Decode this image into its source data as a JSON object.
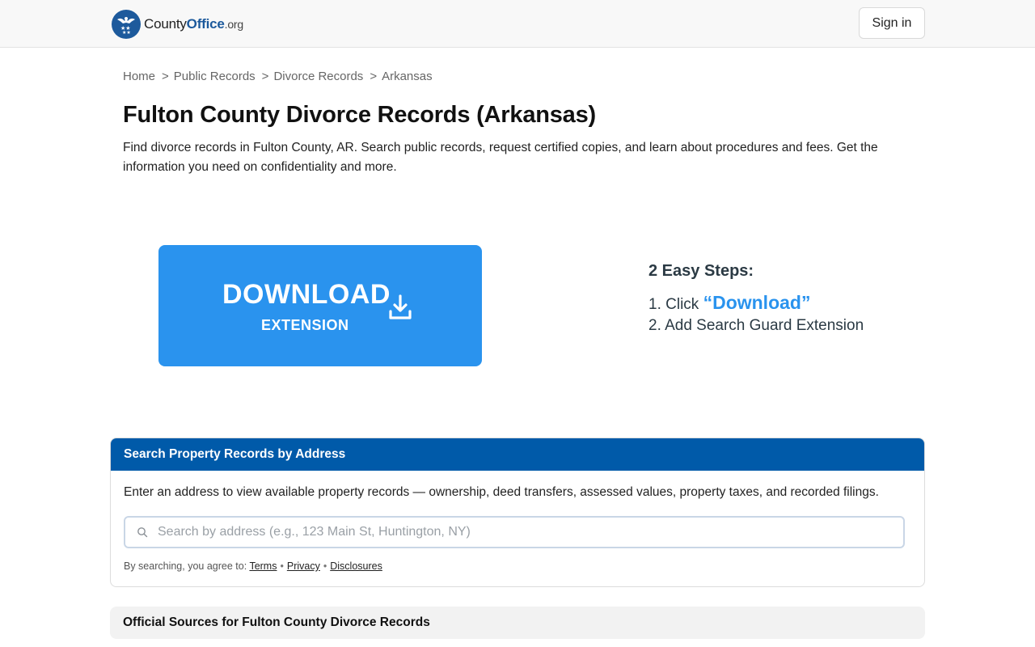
{
  "header": {
    "logo": {
      "name_regular": "County",
      "name_bold": "Office",
      "tld": ".org"
    },
    "signin_label": "Sign in"
  },
  "breadcrumb": [
    "Home",
    "Public Records",
    "Divorce Records",
    "Arkansas"
  ],
  "page": {
    "title": "Fulton County Divorce Records (Arkansas)",
    "intro": "Find divorce records in Fulton County, AR. Search public records, request certified copies, and learn about procedures and fees. Get the information you need on confidentiality and more."
  },
  "download": {
    "main_label": "DOWNLOAD",
    "sub_label": "EXTENSION",
    "icon": "download-icon",
    "color": "#2a93ee"
  },
  "steps": {
    "title": "2 Easy Steps:",
    "step1_prefix": "1. Click ",
    "step1_highlight": "“Download”",
    "step2": "2. Add Search Guard Extension"
  },
  "search": {
    "heading": "Search Property Records by Address",
    "description": "Enter an address to view available property records — ownership, deed transfers, assessed values, property taxes, and recorded filings.",
    "placeholder": "Search by address (e.g., 123 Main St, Huntington, NY)",
    "value": "",
    "agree_prefix": "By searching, you agree to:",
    "links": [
      "Terms",
      "Privacy",
      "Disclosures"
    ],
    "header_color": "#005aa9"
  },
  "sources": {
    "heading": "Official Sources for Fulton County Divorce Records"
  }
}
